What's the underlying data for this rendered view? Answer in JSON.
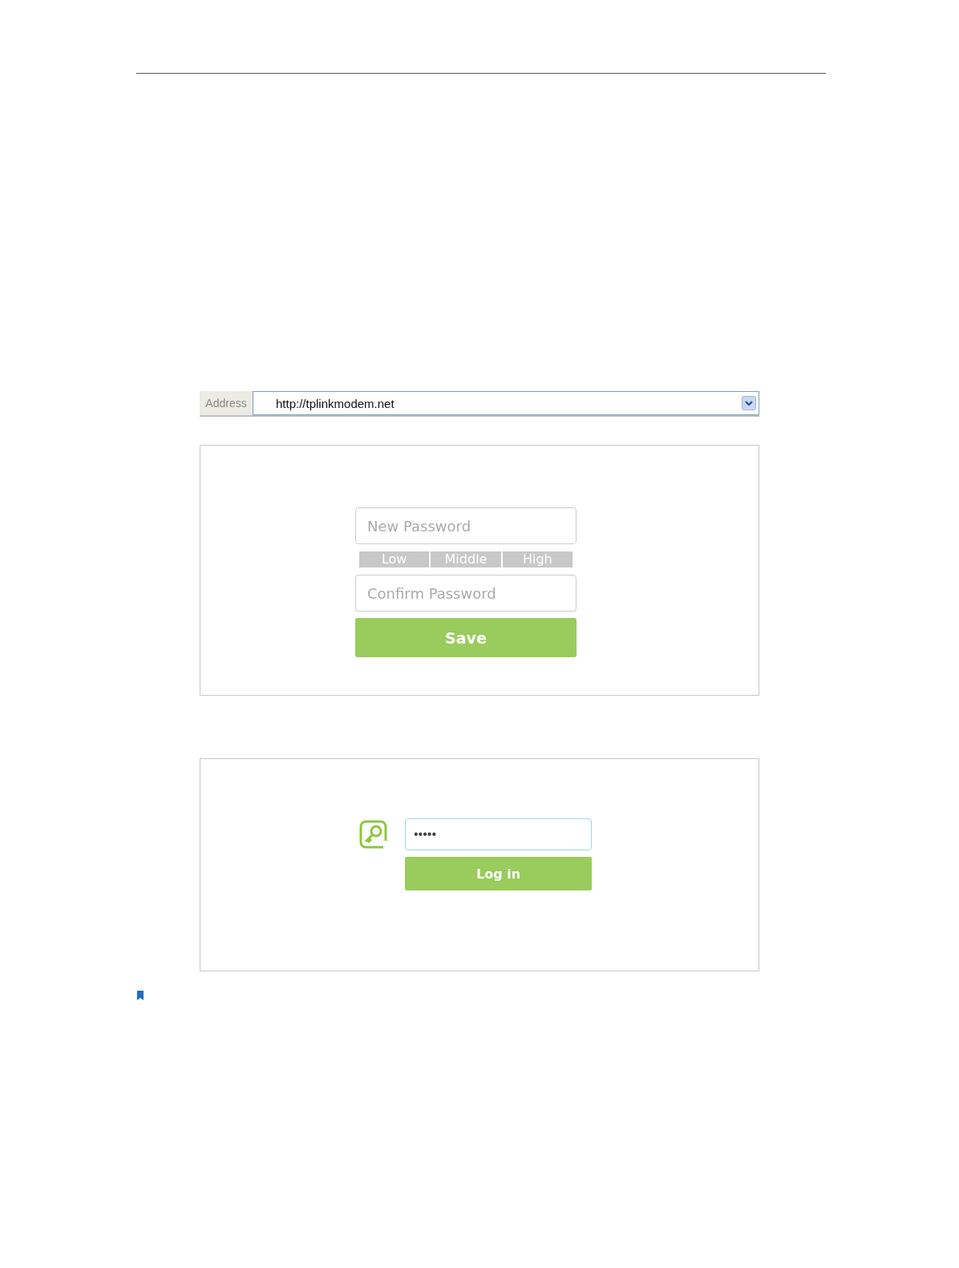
{
  "address_bar": {
    "label": "Address",
    "url": "http://tplinkmodem.net"
  },
  "set_password": {
    "fields": [
      {
        "placeholder": "New Password"
      },
      {
        "placeholder": "Confirm Password"
      }
    ],
    "strength_levels": [
      "Low",
      "Middle",
      "High"
    ],
    "button": "Save"
  },
  "login": {
    "password_value": "•••••",
    "button": "Log in"
  }
}
